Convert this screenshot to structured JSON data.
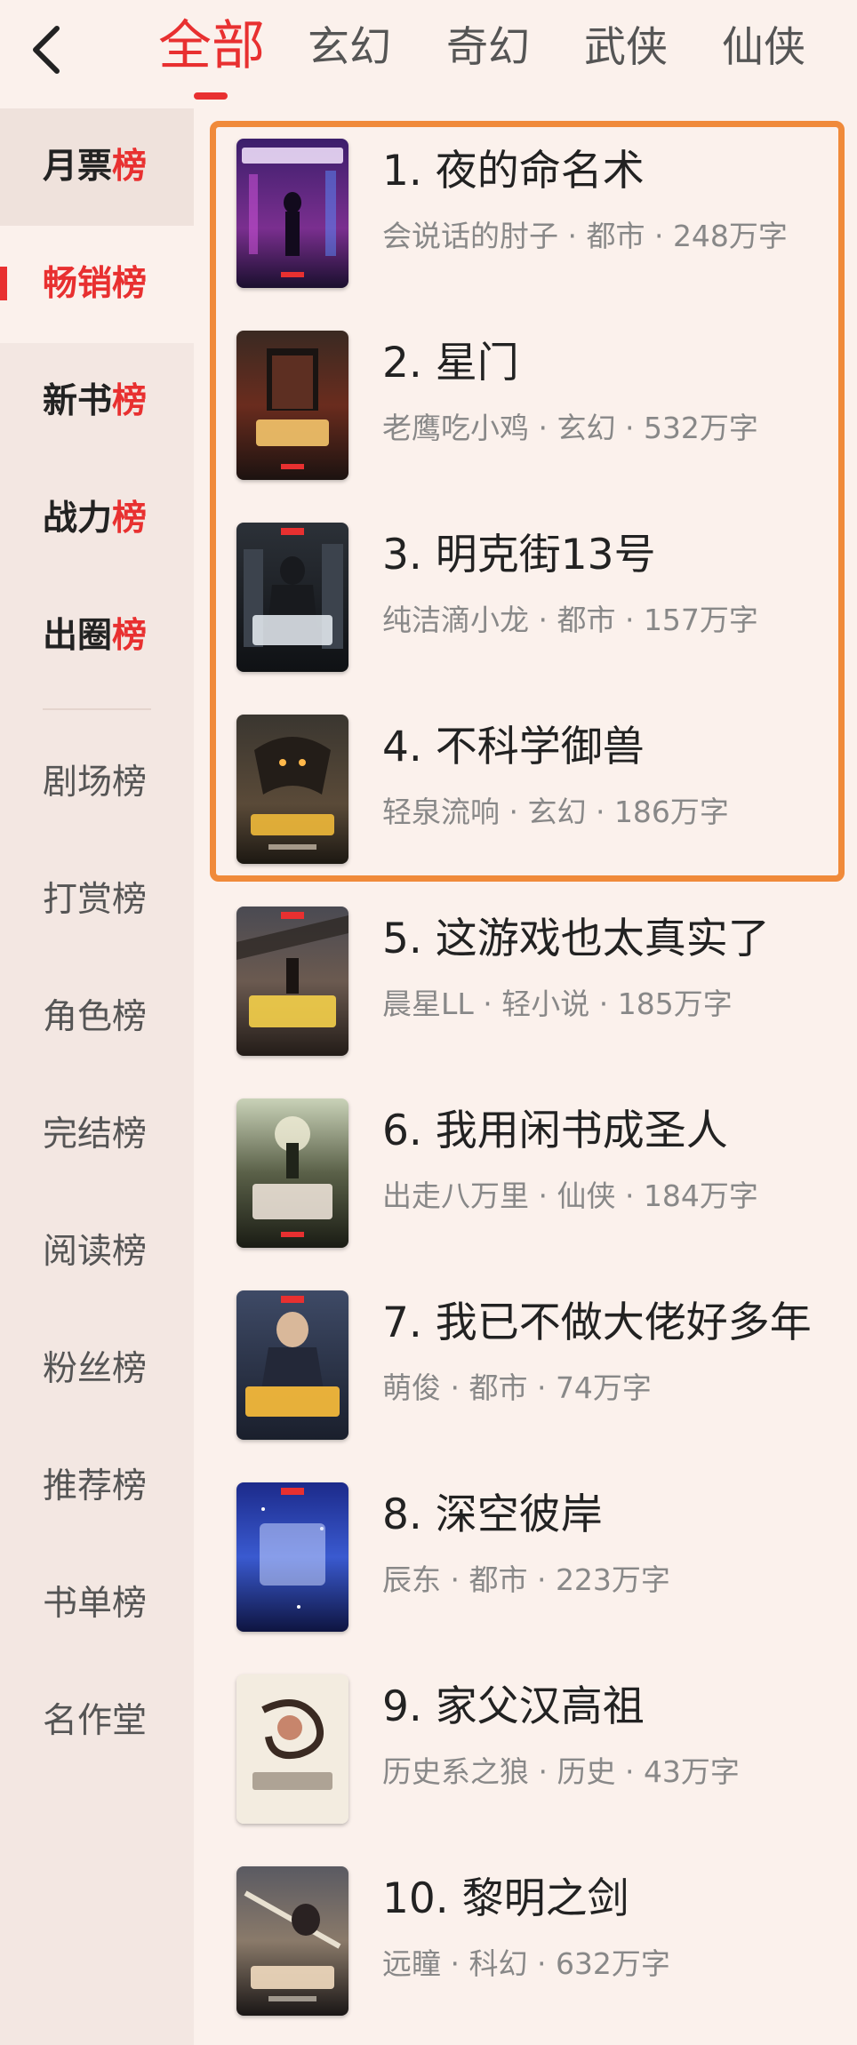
{
  "tabs": [
    {
      "label": "全部"
    },
    {
      "label": "玄幻"
    },
    {
      "label": "奇幻"
    },
    {
      "label": "武侠"
    },
    {
      "label": "仙侠"
    }
  ],
  "sidebar": {
    "primary": [
      {
        "main": "月票",
        "suffix": "榜"
      },
      {
        "main": "畅销",
        "suffix": "榜"
      },
      {
        "main": "新书",
        "suffix": "榜"
      },
      {
        "main": "战力",
        "suffix": "榜"
      },
      {
        "main": "出圈",
        "suffix": "榜"
      }
    ],
    "secondary": [
      {
        "label": "剧场榜"
      },
      {
        "label": "打赏榜"
      },
      {
        "label": "角色榜"
      },
      {
        "label": "完结榜"
      },
      {
        "label": "阅读榜"
      },
      {
        "label": "粉丝榜"
      },
      {
        "label": "推荐榜"
      },
      {
        "label": "书单榜"
      },
      {
        "label": "名作堂"
      }
    ]
  },
  "books": [
    {
      "title": "1. 夜的命名术",
      "meta": "会说话的肘子 · 都市 · 248万字"
    },
    {
      "title": "2. 星门",
      "meta": "老鹰吃小鸡 · 玄幻 · 532万字"
    },
    {
      "title": "3. 明克街13号",
      "meta": "纯洁滴小龙 · 都市 · 157万字"
    },
    {
      "title": "4. 不科学御兽",
      "meta": "轻泉流响 · 玄幻 · 186万字"
    },
    {
      "title": "5. 这游戏也太真实了",
      "meta": "晨星LL · 轻小说 · 185万字"
    },
    {
      "title": "6. 我用闲书成圣人",
      "meta": "出走八万里 · 仙侠 · 184万字"
    },
    {
      "title": "7. 我已不做大佬好多年",
      "meta": "萌俊 · 都市 · 74万字"
    },
    {
      "title": "8. 深空彼岸",
      "meta": "辰东 · 都市 · 223万字"
    },
    {
      "title": "9. 家父汉高祖",
      "meta": "历史系之狼 · 历史 · 43万字"
    },
    {
      "title": "10. 黎明之剑",
      "meta": "远瞳 · 科幻 · 632万字"
    }
  ],
  "colors": {
    "accent": "#e83030",
    "highlight": "#f08a3a",
    "background": "#fbf1ec"
  },
  "icons": {
    "back": "chevron-left-icon"
  }
}
